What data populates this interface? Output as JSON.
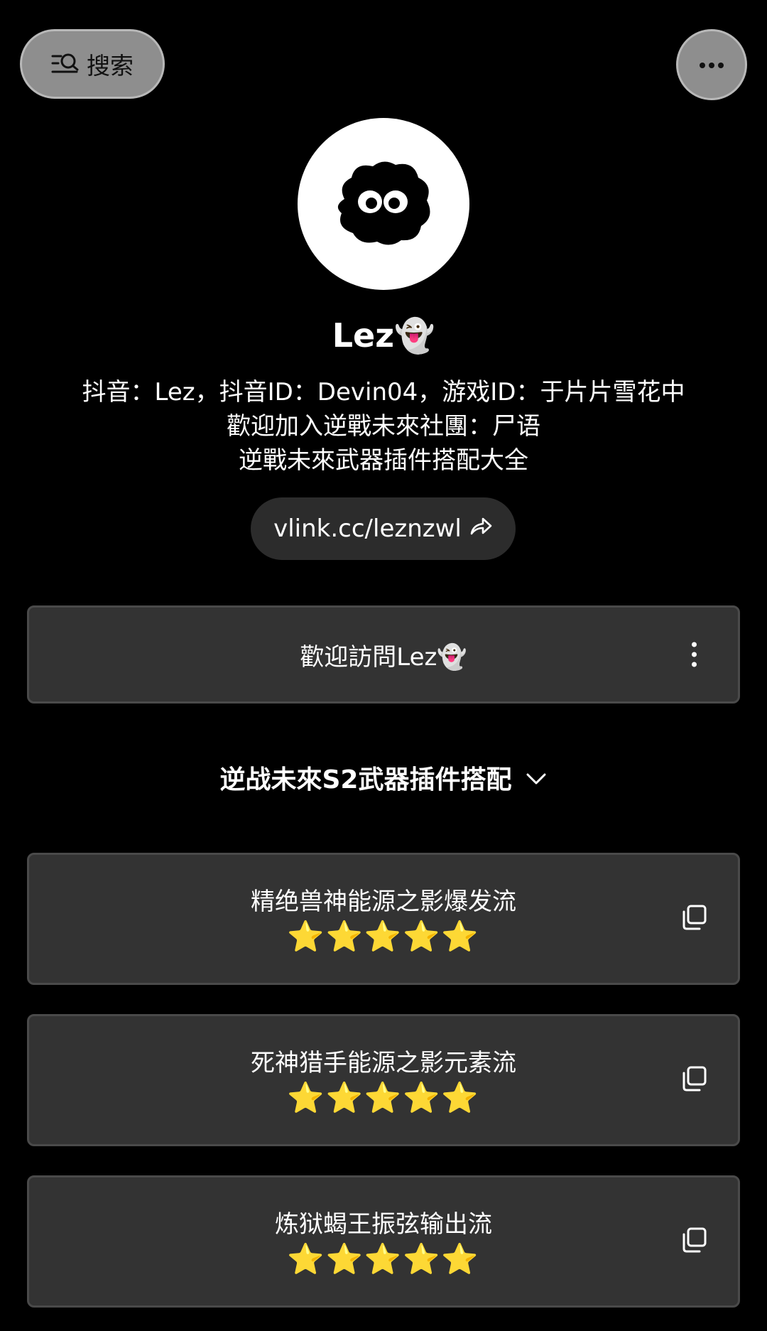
{
  "topbar": {
    "search_label": "搜索",
    "search_icon": "search-list-icon",
    "more_icon": "more-horizontal-icon"
  },
  "profile": {
    "avatar_icon": "soot-sprite-avatar",
    "name": "Lez👻",
    "bio_lines": [
      "抖音：Lez，抖音ID：Devin04，游戏ID：于片片雪花中",
      "歡迎加入逆戰未來社團：尸语",
      "逆戰未來武器插件搭配大全"
    ],
    "link": "vlink.cc/leznzwl",
    "link_icon": "share-arrow-icon"
  },
  "welcome_card": {
    "title": "歡迎訪問Lez👻",
    "menu_icon": "kebab-menu-icon"
  },
  "section": {
    "title": "逆战未來S2武器插件搭配",
    "icon": "chevron-down-icon"
  },
  "items": [
    {
      "title": "精绝兽神能源之影爆发流",
      "stars": "⭐⭐⭐⭐⭐",
      "icon": "copy-icon"
    },
    {
      "title": "死神猎手能源之影元素流",
      "stars": "⭐⭐⭐⭐⭐",
      "icon": "copy-icon"
    },
    {
      "title": "炼狱蝎王振弦输出流",
      "stars": "⭐⭐⭐⭐⭐",
      "icon": "copy-icon"
    }
  ],
  "colors": {
    "background": "#000000",
    "card": "#333333",
    "card_border": "#4a4a4a",
    "pill": "#8e8e8e",
    "link_pill": "#2c2c2c",
    "star": "#f9c623"
  }
}
